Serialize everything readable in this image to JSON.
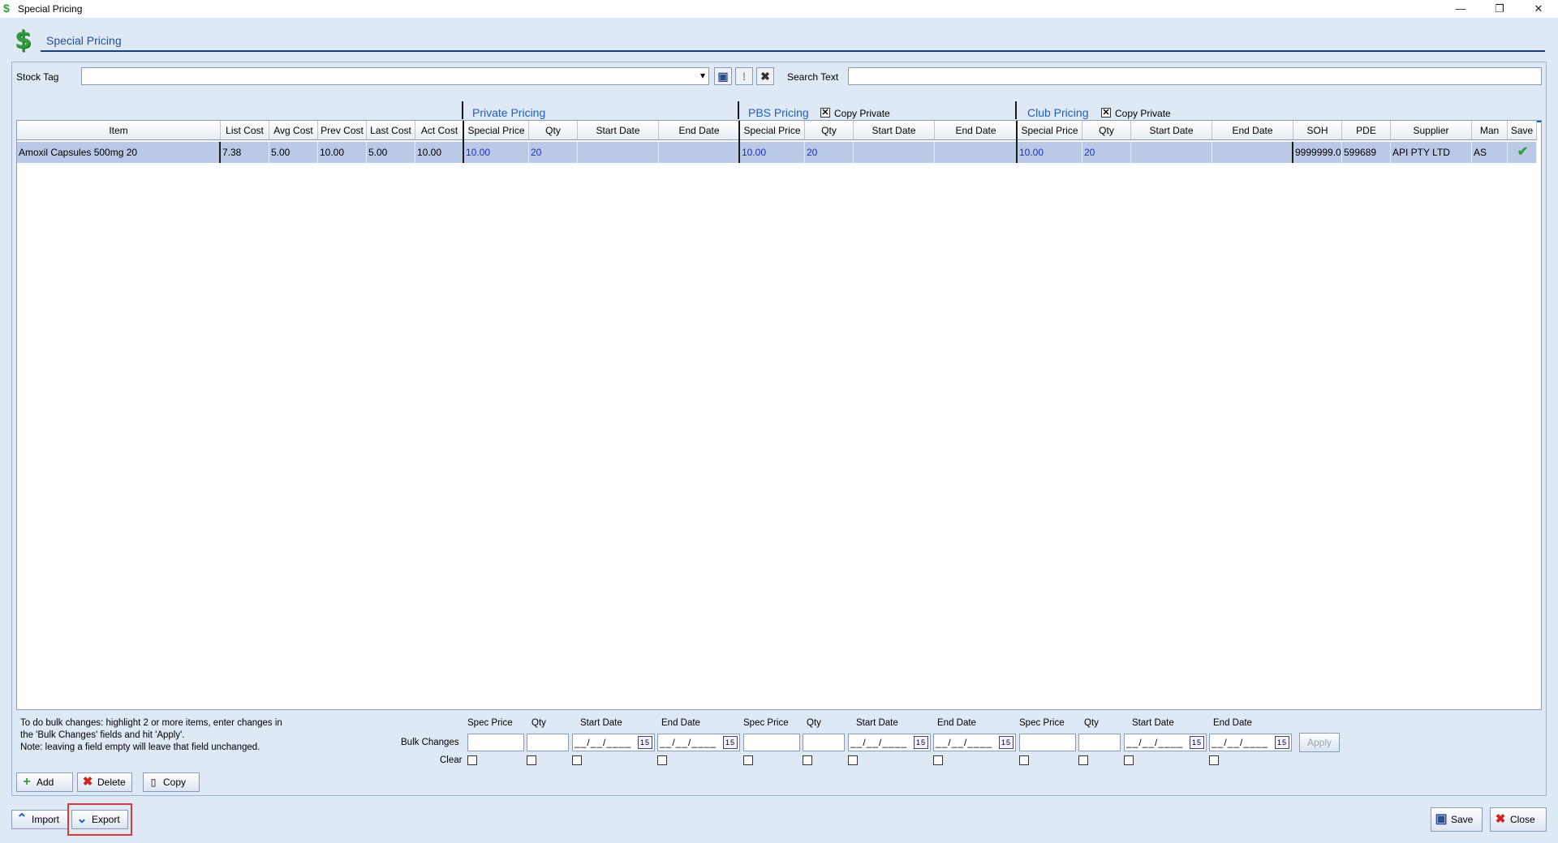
{
  "window": {
    "title": "Special Pricing",
    "header_title": "Special Pricing",
    "minimize": "—",
    "restore": "❐",
    "close": "✕"
  },
  "filters": {
    "stock_tag_label": "Stock Tag",
    "stock_tag_value": "",
    "search_text_label": "Search Text",
    "search_text_value": "",
    "dropdown_arrow": "▾",
    "save_icon": "▣",
    "alert_icon": "!",
    "clear_icon": "✖"
  },
  "groups": {
    "private": "Private Pricing",
    "pbs": "PBS Pricing",
    "club": "Club Pricing",
    "copy_private_label": "Copy Private",
    "pbs_copy_checked": "✕",
    "club_copy_checked": "✕"
  },
  "columns": [
    "Item",
    "List Cost",
    "Avg Cost",
    "Prev Cost",
    "Last Cost",
    "Act Cost",
    "Special Price",
    "Qty",
    "Start Date",
    "End Date",
    "Special Price",
    "Qty",
    "Start Date",
    "End Date",
    "Special Price",
    "Qty",
    "Start Date",
    "End Date",
    "SOH",
    "PDE",
    "Supplier",
    "Man",
    "Save"
  ],
  "rows": [
    {
      "item": "Amoxil Capsules 500mg 20",
      "list_cost": "7.38",
      "avg_cost": "5.00",
      "prev_cost": "10.00",
      "last_cost": "5.00",
      "act_cost": "10.00",
      "private_special_price": "10.00",
      "private_qty": "20",
      "private_start": "",
      "private_end": "",
      "pbs_special_price": "10.00",
      "pbs_qty": "20",
      "pbs_start": "",
      "pbs_end": "",
      "club_special_price": "10.00",
      "club_qty": "20",
      "club_start": "",
      "club_end": "",
      "soh": "9999999.0",
      "pde": "599689",
      "supplier": "API PTY LTD",
      "man": "AS",
      "save": "✔"
    }
  ],
  "bulk": {
    "help_line1": "To do bulk changes: highlight 2 or more items, enter changes in",
    "help_line2": "the 'Bulk Changes' fields and hit 'Apply'.",
    "help_line3": "Note: leaving a field empty will leave that field unchanged.",
    "bulk_changes_label": "Bulk Changes",
    "clear_label": "Clear",
    "col_spec_price": "Spec Price",
    "col_qty": "Qty",
    "col_start_date": "Start Date",
    "col_end_date": "End Date",
    "date_placeholder": "__/__/____",
    "calendar_icon": "15",
    "apply_label": "Apply"
  },
  "actions": {
    "add": "Add",
    "delete": "Delete",
    "copy": "Copy",
    "import": "Import",
    "export": "Export",
    "save": "Save",
    "close": "Close",
    "add_icon": "+",
    "delete_icon": "✖",
    "copy_icon": "▯",
    "import_icon": "⌃",
    "export_icon": "⌄",
    "save_icon": "▣",
    "close_icon": "✖",
    "dollar_icon": "$"
  },
  "colors": {
    "accent": "#1f5fbf",
    "selected_row": "#b9c9e6",
    "highlight": "#d93a3a",
    "save_check": "#2f9d3a"
  }
}
